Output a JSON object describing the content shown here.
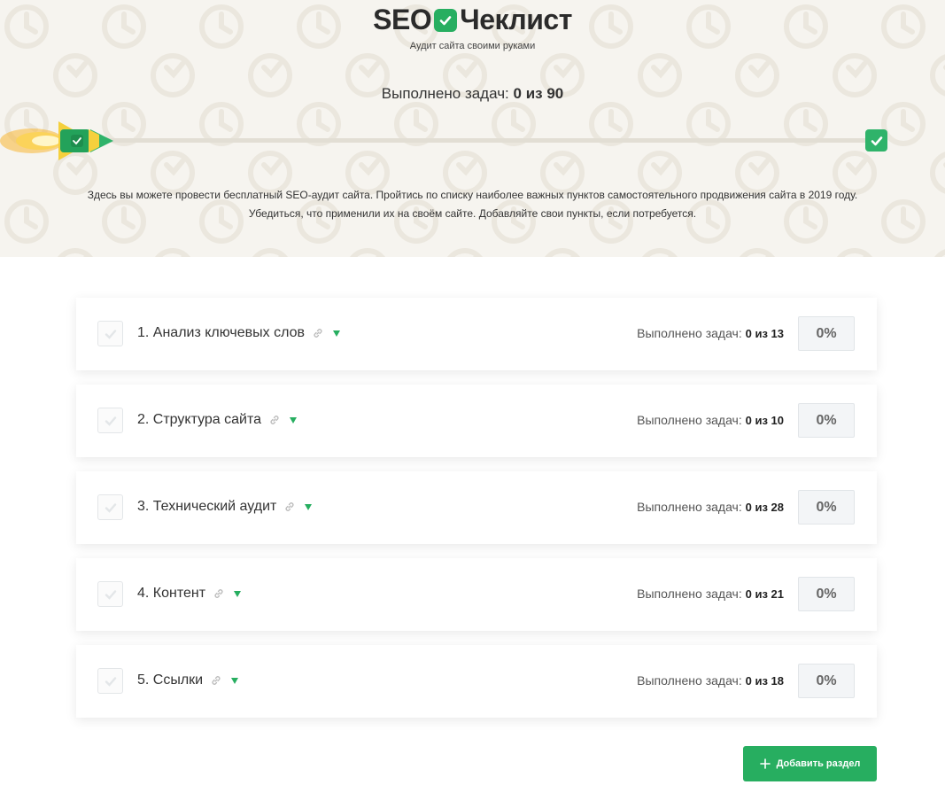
{
  "header": {
    "logo_left": "SEO",
    "logo_right": "Чеклист",
    "tagline": "Аудит сайта своими руками",
    "total_label": "Выполнено задач:",
    "total_value": "0 из 90",
    "progress_fraction": 0,
    "description_line1": "Здесь вы можете провести бесплатный SEO-аудит сайта. Пройтись по списку наиболее важных пунктов самостоятельного продвижения сайта в 2019 году.",
    "description_line2": "Убедиться, что применили их на своём сайте. Добавляйте свои пункты, если потребуется."
  },
  "sections": [
    {
      "title": "1. Анализ ключевых слов",
      "progress_label": "Выполнено задач:",
      "progress_value": "0 из 13",
      "percent": "0%"
    },
    {
      "title": "2. Структура сайта",
      "progress_label": "Выполнено задач:",
      "progress_value": "0 из 10",
      "percent": "0%"
    },
    {
      "title": "3. Технический аудит",
      "progress_label": "Выполнено задач:",
      "progress_value": "0 из 28",
      "percent": "0%"
    },
    {
      "title": "4. Контент",
      "progress_label": "Выполнено задач:",
      "progress_value": "0 из 21",
      "percent": "0%"
    },
    {
      "title": "5. Ссылки",
      "progress_label": "Выполнено задач:",
      "progress_value": "0 из 18",
      "percent": "0%"
    }
  ],
  "actions": {
    "add_section_label": "Добавить раздел"
  },
  "colors": {
    "accent": "#27ae60",
    "hero_bg": "#f6f4ef"
  }
}
